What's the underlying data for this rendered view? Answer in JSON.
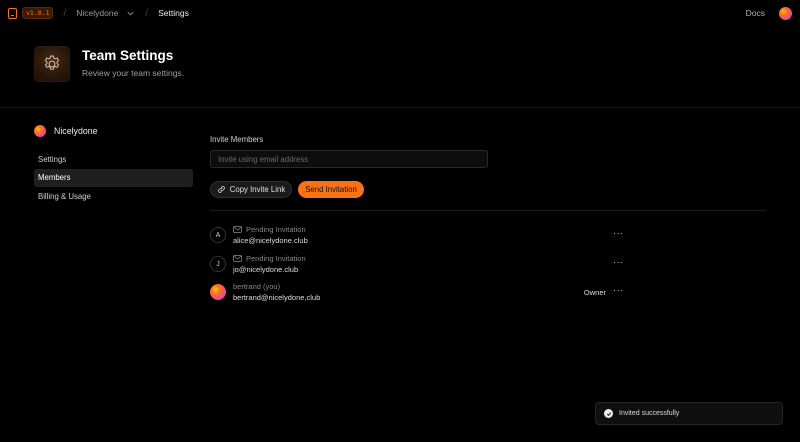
{
  "nav": {
    "version": "v1.0.1",
    "team_crumb": "Nicelydone",
    "current_crumb": "Settings",
    "docs_label": "Docs"
  },
  "header": {
    "title": "Team Settings",
    "subtitle": "Review your team settings."
  },
  "sidebar": {
    "team_name": "Nicelydone",
    "items": [
      {
        "label": "Settings",
        "active": false
      },
      {
        "label": "Members",
        "active": true
      },
      {
        "label": "Billing & Usage",
        "active": false
      }
    ]
  },
  "invite": {
    "label": "Invite Members",
    "placeholder": "Invite using email address",
    "value": "",
    "copy_label": "Copy Invite Link",
    "send_label": "Send Invitation"
  },
  "members": [
    {
      "initial": "A",
      "status": "Pending Invitation",
      "email": "alice@nicelydone.club",
      "role": "",
      "menu": "···"
    },
    {
      "initial": "J",
      "status": "Pending Invitation",
      "email": "jo@nicelydone.club",
      "role": "",
      "menu": "···"
    },
    {
      "initial": "",
      "status": "bertrand (you)",
      "email": "bertrand@nicelydone.club",
      "role": "Owner",
      "menu": "···"
    }
  ],
  "toast": {
    "message": "Invited successfully"
  },
  "colors": {
    "accent": "#f97316",
    "background": "#000000"
  },
  "icons": {
    "settings": "gear-icon",
    "copy": "link-icon",
    "pending": "mail-icon",
    "menu": "more-horizontal-icon",
    "success": "check-circle-icon"
  }
}
